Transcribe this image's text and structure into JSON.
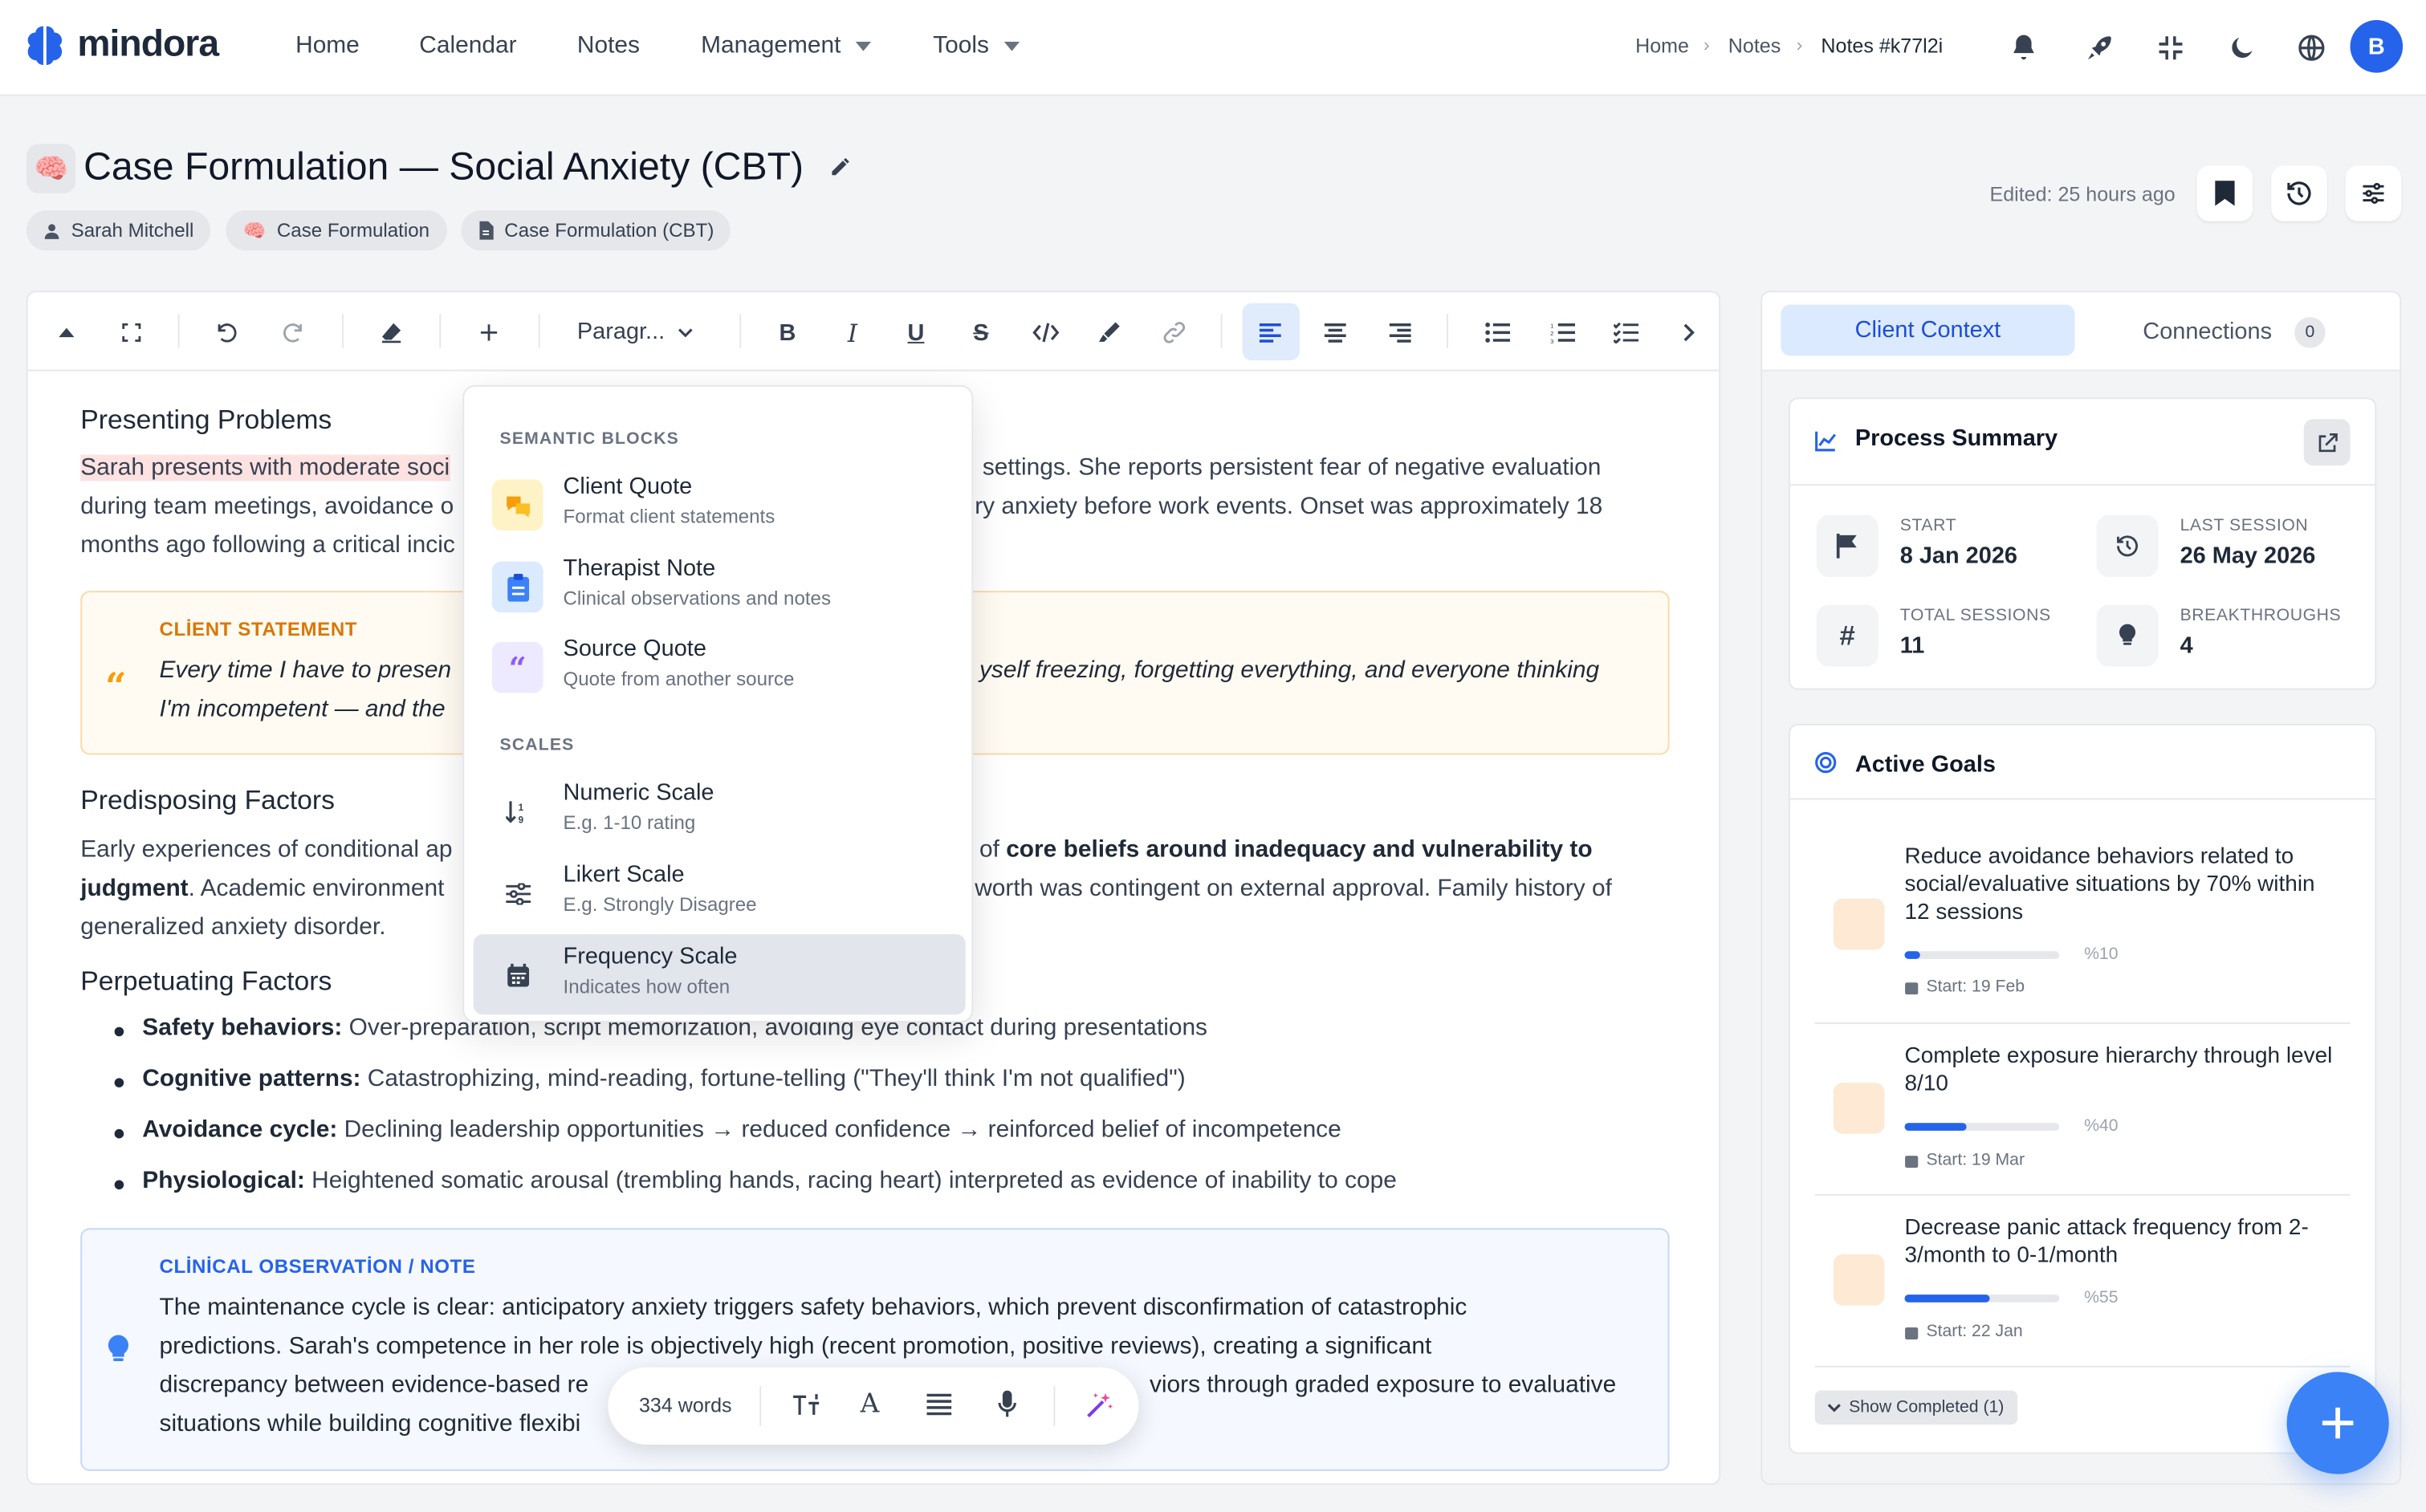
{
  "app": {
    "name": "mindora"
  },
  "nav": {
    "home": "Home",
    "calendar": "Calendar",
    "notes": "Notes",
    "management": "Management",
    "tools": "Tools"
  },
  "breadcrumb": {
    "home": "Home",
    "notes": "Notes",
    "current": "Notes #k77l2i"
  },
  "user": {
    "initial": "B"
  },
  "page": {
    "title": "Case Formulation — Social Anxiety (CBT)",
    "title_icon": "🧠",
    "chips": [
      "Sarah Mitchell",
      "Case Formulation",
      "Case Formulation (CBT)"
    ],
    "edited": "Edited: 25 hours ago"
  },
  "toolbar": {
    "paragraph": "Paragr..."
  },
  "doc": {
    "h_presenting": "Presenting Problems",
    "p1_hl": "Sarah presents with moderate soci",
    "p1_tail": " settings. She reports persistent fear of negative evaluation",
    "p1_l2a": "during team meetings, avoidance o",
    "p1_l2b": "ry anxiety before work events. Onset was approximately 18",
    "p1_l3": "months ago following a critical incic",
    "client_label": "CLİENT STATEMENT",
    "client_l1a": "Every time I have to presen",
    "client_l1b": "yself freezing, forgetting everything, and everyone thinking",
    "client_l2": "I'm incompetent — and the",
    "h_predisposing": "Predisposing Factors",
    "p2_l1a": "Early experiences of conditional ap",
    "p2_l1b": "of ",
    "p2_l1bold": "core beliefs around inadequacy and vulnerability to",
    "p2_l2bold": "judgment",
    "p2_l2a": ". Academic environment",
    "p2_l2b": "worth was contingent on external approval. Family history of",
    "p2_l3": "generalized anxiety disorder.",
    "h_perpetuating": "Perpetuating Factors",
    "bullets": [
      {
        "label": "Safety behaviors:",
        "text": " Over-preparation, script memorization, avoiding eye contact during presentations"
      },
      {
        "label": "Cognitive patterns:",
        "text": " Catastrophizing, mind-reading, fortune-telling (\"They'll think I'm not qualified\")"
      },
      {
        "label": "Avoidance cycle:",
        "text": " Declining leadership opportunities → reduced confidence → reinforced belief of incompetence"
      },
      {
        "label": "Physiological:",
        "text": " Heightened somatic arousal (trembling hands, racing heart) interpreted as evidence of inability to cope"
      }
    ],
    "note_label": "CLİNİCAL OBSERVATİON / NOTE",
    "note_l1": "The maintenance cycle is clear: anticipatory anxiety triggers safety behaviors, which prevent disconfirmation of catastrophic",
    "note_l2": "predictions. Sarah's competence in her role is objectively high (recent promotion, positive reviews), creating a significant",
    "note_l3a": "discrepancy between evidence-based re",
    "note_l3b": "viors through graded exposure to evaluative",
    "note_l4": "situations while building cognitive flexibi"
  },
  "floatbar": {
    "words": "334 words"
  },
  "dropdown": {
    "section1": "SEMANTIC BLOCKS",
    "section2": "SCALES",
    "items": [
      {
        "title": "Client Quote",
        "sub": "Format client statements",
        "icon": "chat-bubbles-icon",
        "color": "#f59e0b"
      },
      {
        "title": "Therapist Note",
        "sub": "Clinical observations and notes",
        "icon": "clipboard-icon",
        "color": "#3b82f6"
      },
      {
        "title": "Source Quote",
        "sub": "Quote from another source",
        "icon": "quote-icon",
        "color": "#8b5cf6"
      },
      {
        "title": "Numeric Scale",
        "sub": "E.g. 1-10 rating",
        "icon": "sort-numeric-icon",
        "color": "#374151"
      },
      {
        "title": "Likert Scale",
        "sub": "E.g. Strongly Disagree",
        "icon": "sliders-icon",
        "color": "#374151"
      },
      {
        "title": "Frequency Scale",
        "sub": "Indicates how often",
        "icon": "calendar-icon",
        "color": "#374151"
      }
    ]
  },
  "panel": {
    "tab_active": "Client Context",
    "tab_other": "Connections",
    "connections_count": "0",
    "summary_title": "Process Summary",
    "stats": [
      {
        "label": "START",
        "value": "8 Jan 2026",
        "icon": "flag-icon"
      },
      {
        "label": "LAST SESSION",
        "value": "26 May 2026",
        "icon": "history-icon"
      },
      {
        "label": "TOTAL SESSIONS",
        "value": "11",
        "icon": "hash-icon"
      },
      {
        "label": "BREAKTHROUGHS",
        "value": "4",
        "icon": "lightbulb-icon"
      }
    ],
    "goals_title": "Active Goals",
    "goals": [
      {
        "text": "Reduce avoidance behaviors related to social/evaluative situations by 70% within 12 sessions",
        "pct_label": "%10",
        "progress": 0.1,
        "date": "Start: 19 Feb"
      },
      {
        "text": "Complete exposure hierarchy through level 8/10",
        "pct_label": "%40",
        "progress": 0.4,
        "date": "Start: 19 Mar"
      },
      {
        "text": "Decrease panic attack frequency from 2-3/month to 0-1/month",
        "pct_label": "%55",
        "progress": 0.55,
        "date": "Start: 22 Jan"
      }
    ],
    "show_completed": "Show Completed (1)"
  },
  "colors": {
    "accent": "#2563eb",
    "highlight": "#fde2e1",
    "client_accent": "#d97706",
    "note_accent": "#2563eb"
  }
}
